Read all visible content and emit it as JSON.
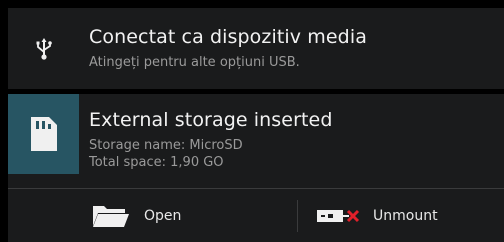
{
  "usb_notification": {
    "icon": "usb-icon",
    "title": "Conectat ca dispozitiv media",
    "subtitle": "Atingeți pentru alte opțiuni USB."
  },
  "storage_notification": {
    "icon": "sd-card-icon",
    "title": "External storage inserted",
    "storage_name": "Storage name: MicroSD",
    "total_space": "Total space: 1,90 GO",
    "actions": [
      {
        "icon": "folder-icon",
        "label": "Open"
      },
      {
        "icon": "unmount-icon",
        "label": "Unmount"
      }
    ]
  },
  "colors": {
    "background": "#000000",
    "notification_bg": "#1a1b1c",
    "sd_icon_bg": "#275563",
    "title_text": "#f2f2f2",
    "subtitle_text": "#9a9a9a",
    "unmount_x": "#e0202a"
  }
}
